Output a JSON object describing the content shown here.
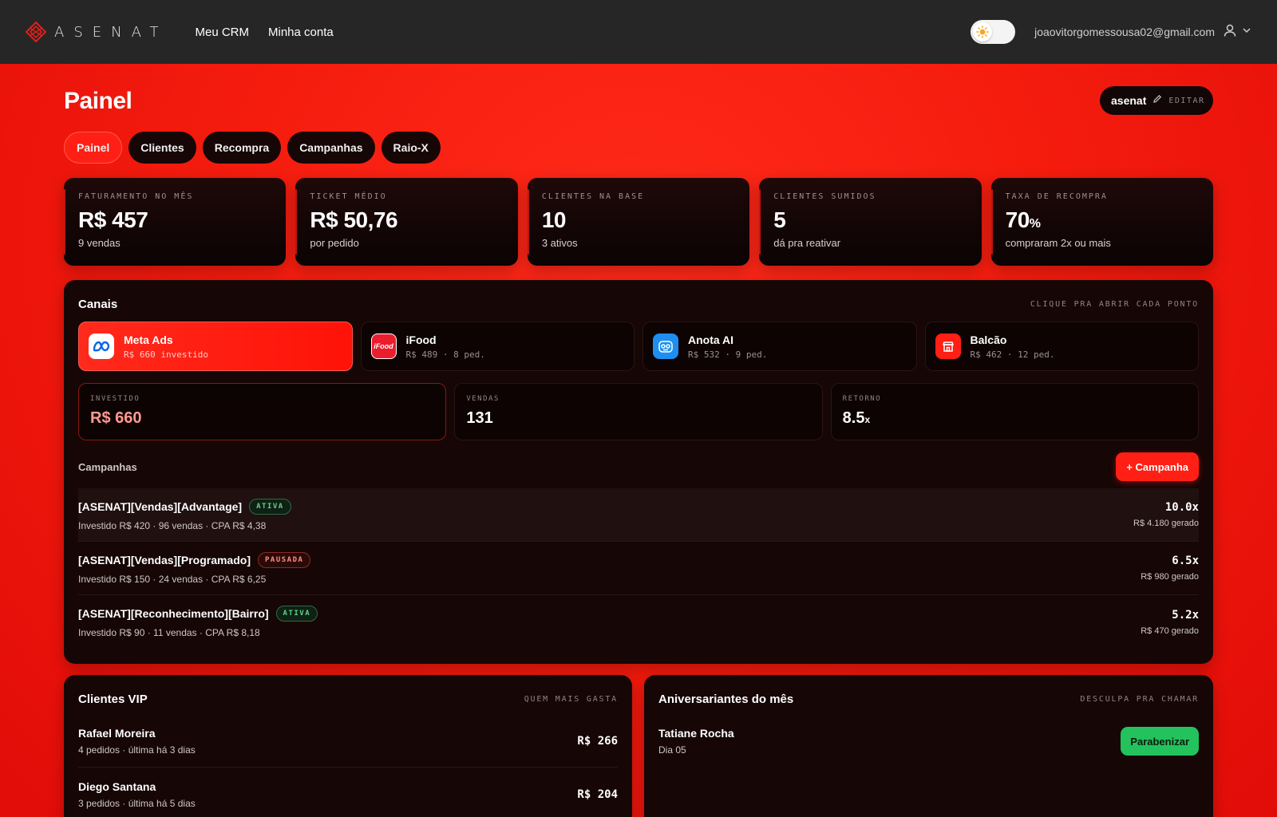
{
  "topbar": {
    "logo_text": "ASENAT",
    "nav": [
      "Meu CRM",
      "Minha conta"
    ],
    "user_email": "joaovitorgomessousa02@gmail.com"
  },
  "header": {
    "title": "Painel",
    "workspace_name": "asenat",
    "edit_label": "EDITAR"
  },
  "tabs": [
    "Painel",
    "Clientes",
    "Recompra",
    "Campanhas",
    "Raio-X"
  ],
  "kpis": [
    {
      "label": "FATURAMENTO NO MÊS",
      "value": "R$ 457",
      "unit": "",
      "sub": "9 vendas"
    },
    {
      "label": "TICKET MÉDIO",
      "value": "R$ 50,76",
      "unit": "",
      "sub": "por pedido"
    },
    {
      "label": "CLIENTES NA BASE",
      "value": "10",
      "unit": "",
      "sub": "3 ativos"
    },
    {
      "label": "CLIENTES SUMIDOS",
      "value": "5",
      "unit": "",
      "sub": "dá pra reativar"
    },
    {
      "label": "TAXA DE RECOMPRA",
      "value": "70",
      "unit": "%",
      "sub": "compraram 2x ou mais"
    }
  ],
  "channels_panel": {
    "title": "Canais",
    "hint": "CLIQUE PRA ABRIR CADA PONTO",
    "channels": [
      {
        "name": "Meta Ads",
        "meta": "R$ 660 investido",
        "icon": "meta-icon"
      },
      {
        "name": "iFood",
        "meta": "R$ 489 · 8 ped.",
        "icon": "ifood-icon"
      },
      {
        "name": "Anota AI",
        "meta": "R$ 532 · 9 ped.",
        "icon": "anota-ai-icon"
      },
      {
        "name": "Balcão",
        "meta": "R$ 462 · 12 ped.",
        "icon": "store-icon"
      }
    ],
    "metrics": [
      {
        "label": "INVESTIDO",
        "value": "R$ 660",
        "unit": ""
      },
      {
        "label": "VENDAS",
        "value": "131",
        "unit": ""
      },
      {
        "label": "RETORNO",
        "value": "8.5",
        "unit": "x"
      }
    ],
    "campaigns_title": "Campanhas",
    "add_campaign_label": "+ Campanha",
    "campaigns": [
      {
        "name": "[ASENAT][Vendas][Advantage]",
        "status": "ATIVA",
        "desc": "Investido R$ 420 · 96 vendas · CPA R$ 4,38",
        "roi": "10.0x",
        "generated": "R$ 4.180 gerado"
      },
      {
        "name": "[ASENAT][Vendas][Programado]",
        "status": "PAUSADA",
        "desc": "Investido R$ 150 · 24 vendas · CPA R$ 6,25",
        "roi": "6.5x",
        "generated": "R$ 980 gerado"
      },
      {
        "name": "[ASENAT][Reconhecimento][Bairro]",
        "status": "ATIVA",
        "desc": "Investido R$ 90 · 11 vendas · CPA R$ 8,18",
        "roi": "5.2x",
        "generated": "R$ 470 gerado"
      }
    ]
  },
  "vip_panel": {
    "title": "Clientes VIP",
    "hint": "QUEM MAIS GASTA",
    "clients": [
      {
        "name": "Rafael Moreira",
        "sub": "4 pedidos · última há 3 dias",
        "amount": "R$ 266"
      },
      {
        "name": "Diego Santana",
        "sub": "3 pedidos · última há 5 dias",
        "amount": "R$ 204"
      }
    ]
  },
  "birthday_panel": {
    "title": "Aniversariantes do mês",
    "hint": "DESCULPA PRA CHAMAR",
    "people": [
      {
        "name": "Tatiane Rocha",
        "sub": "Dia 05",
        "action": "Parabenizar"
      }
    ]
  },
  "colors": {
    "accent": "#ff1f14",
    "panel": "#160606",
    "topbar": "#262626",
    "success": "#23c25c"
  }
}
